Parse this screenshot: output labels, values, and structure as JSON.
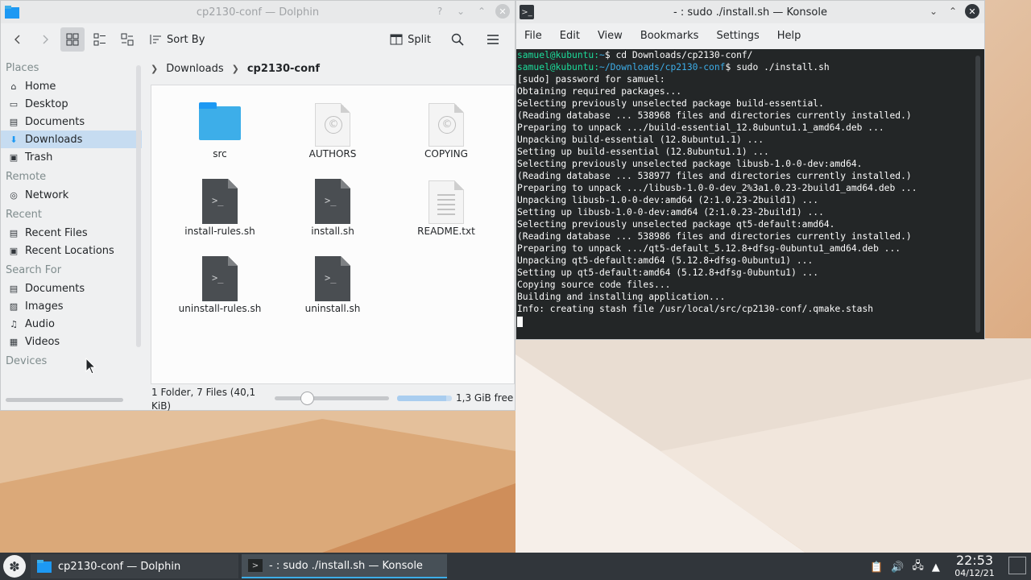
{
  "dolphin": {
    "title": "cp2130-conf — Dolphin",
    "toolbar": {
      "sort_label": "Sort By",
      "split_label": "Split"
    },
    "places": {
      "sections": [
        {
          "title": "Places",
          "items": [
            {
              "label": "Home",
              "icon": "home-icon"
            },
            {
              "label": "Desktop",
              "icon": "desktop-icon"
            },
            {
              "label": "Documents",
              "icon": "documents-icon"
            },
            {
              "label": "Downloads",
              "icon": "downloads-icon",
              "selected": true
            },
            {
              "label": "Trash",
              "icon": "trash-icon"
            }
          ]
        },
        {
          "title": "Remote",
          "items": [
            {
              "label": "Network",
              "icon": "network-icon"
            }
          ]
        },
        {
          "title": "Recent",
          "items": [
            {
              "label": "Recent Files",
              "icon": "recent-files-icon"
            },
            {
              "label": "Recent Locations",
              "icon": "recent-locations-icon"
            }
          ]
        },
        {
          "title": "Search For",
          "items": [
            {
              "label": "Documents",
              "icon": "documents-icon"
            },
            {
              "label": "Images",
              "icon": "images-icon"
            },
            {
              "label": "Audio",
              "icon": "audio-icon"
            },
            {
              "label": "Videos",
              "icon": "videos-icon"
            }
          ]
        },
        {
          "title": "Devices",
          "items": []
        }
      ]
    },
    "breadcrumb": [
      "Downloads",
      "cp2130-conf"
    ],
    "files": [
      {
        "name": "src",
        "type": "folder"
      },
      {
        "name": "AUTHORS",
        "type": "license"
      },
      {
        "name": "COPYING",
        "type": "license"
      },
      {
        "name": "install-rules.sh",
        "type": "script"
      },
      {
        "name": "install.sh",
        "type": "script"
      },
      {
        "name": "README.txt",
        "type": "text"
      },
      {
        "name": "uninstall-rules.sh",
        "type": "script"
      },
      {
        "name": "uninstall.sh",
        "type": "script"
      }
    ],
    "status": {
      "count": "1 Folder, 7 Files (40,1 KiB)",
      "free": "1,3 GiB free",
      "used_fraction": 0.9
    }
  },
  "konsole": {
    "title": "- : sudo ./install.sh — Konsole",
    "menu": [
      "File",
      "Edit",
      "View",
      "Bookmarks",
      "Settings",
      "Help"
    ],
    "prompt_user": "samuel@kubuntu",
    "lines": [
      {
        "kind": "prompt",
        "path": "~",
        "cmd": "cd Downloads/cp2130-conf/"
      },
      {
        "kind": "prompt",
        "path": "~/Downloads/cp2130-conf",
        "cmd": "sudo ./install.sh"
      },
      {
        "kind": "out",
        "text": "[sudo] password for samuel:"
      },
      {
        "kind": "out",
        "text": "Obtaining required packages..."
      },
      {
        "kind": "out",
        "text": "Selecting previously unselected package build-essential."
      },
      {
        "kind": "out",
        "text": "(Reading database ... 538968 files and directories currently installed.)"
      },
      {
        "kind": "out",
        "text": "Preparing to unpack .../build-essential_12.8ubuntu1.1_amd64.deb ..."
      },
      {
        "kind": "out",
        "text": "Unpacking build-essential (12.8ubuntu1.1) ..."
      },
      {
        "kind": "out",
        "text": "Setting up build-essential (12.8ubuntu1.1) ..."
      },
      {
        "kind": "out",
        "text": "Selecting previously unselected package libusb-1.0-0-dev:amd64."
      },
      {
        "kind": "out",
        "text": "(Reading database ... 538977 files and directories currently installed.)"
      },
      {
        "kind": "out",
        "text": "Preparing to unpack .../libusb-1.0-0-dev_2%3a1.0.23-2build1_amd64.deb ..."
      },
      {
        "kind": "out",
        "text": "Unpacking libusb-1.0-0-dev:amd64 (2:1.0.23-2build1) ..."
      },
      {
        "kind": "out",
        "text": "Setting up libusb-1.0-0-dev:amd64 (2:1.0.23-2build1) ..."
      },
      {
        "kind": "out",
        "text": "Selecting previously unselected package qt5-default:amd64."
      },
      {
        "kind": "out",
        "text": "(Reading database ... 538986 files and directories currently installed.)"
      },
      {
        "kind": "out",
        "text": "Preparing to unpack .../qt5-default_5.12.8+dfsg-0ubuntu1_amd64.deb ..."
      },
      {
        "kind": "out",
        "text": "Unpacking qt5-default:amd64 (5.12.8+dfsg-0ubuntu1) ..."
      },
      {
        "kind": "out",
        "text": "Setting up qt5-default:amd64 (5.12.8+dfsg-0ubuntu1) ..."
      },
      {
        "kind": "out",
        "text": "Copying source code files..."
      },
      {
        "kind": "out",
        "text": "Building and installing application..."
      },
      {
        "kind": "out",
        "text": "Info: creating stash file /usr/local/src/cp2130-conf/.qmake.stash"
      },
      {
        "kind": "cursor"
      }
    ]
  },
  "taskbar": {
    "tasks": [
      {
        "label": "cp2130-conf — Dolphin"
      },
      {
        "label": "- : sudo ./install.sh — Konsole"
      }
    ],
    "clock": {
      "time": "22:53",
      "date": "04/12/21"
    }
  }
}
